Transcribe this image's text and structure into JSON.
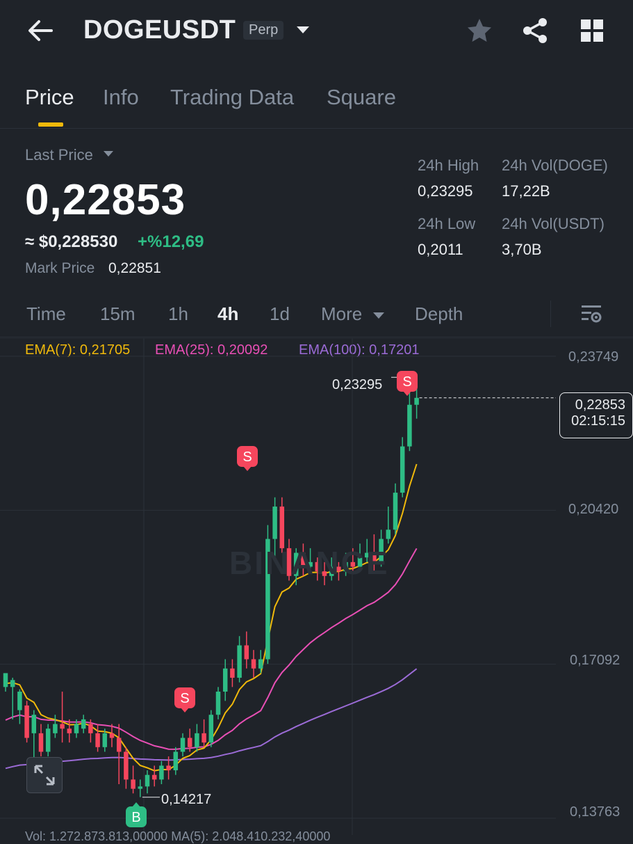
{
  "header": {
    "symbol": "DOGEUSDT",
    "contract_type": "Perp",
    "icons": [
      "back-arrow-icon",
      "dropdown-caret-icon",
      "star-icon",
      "share-icon",
      "grid-icon"
    ]
  },
  "tabs": [
    {
      "label": "Price",
      "active": true
    },
    {
      "label": "Info"
    },
    {
      "label": "Trading Data"
    },
    {
      "label": "Square"
    }
  ],
  "price": {
    "last_price_label": "Last Price",
    "last_price": "0,22853",
    "approx_usd": "≈ $0,228530",
    "change_pct": "+%12,69",
    "mark_price_label": "Mark Price",
    "mark_price": "0,22851"
  },
  "stats": {
    "high_label": "24h High",
    "high": "0,23295",
    "vol_doge_label": "24h Vol(DOGE)",
    "vol_doge": "17,22B",
    "low_label": "24h Low",
    "low": "0,2011",
    "vol_usdt_label": "24h Vol(USDT)",
    "vol_usdt": "3,70B"
  },
  "intervals": {
    "items": [
      "Time",
      "15m",
      "1h",
      "4h",
      "1d",
      "More",
      "Depth"
    ],
    "active": "4h"
  },
  "indicators": {
    "ema7": "EMA(7): 0,21705",
    "ema25": "EMA(25): 0,20092",
    "ema100": "EMA(100): 0,17201"
  },
  "colors": {
    "background": "#1f2329",
    "up": "#2ebd85",
    "down": "#f6465d",
    "accent": "#f0b90b",
    "ema7": "#f0b90b",
    "ema25": "#e84fb5",
    "ema100": "#9b6bd6"
  },
  "chart_data": {
    "type": "candlestick",
    "watermark": "BINANCE",
    "y_axis_ticks": [
      "0,23749",
      "0,20420",
      "0,17092",
      "0,13763"
    ],
    "ylim": [
      0.13763,
      0.23749
    ],
    "current_price": "0,22853",
    "countdown": "02:15:15",
    "high_marker": "0,23295",
    "low_marker": "0,14217",
    "signals": [
      {
        "label": "S",
        "type": "sell",
        "candle_index": 55,
        "price": 0.1625
      },
      {
        "label": "S",
        "type": "sell",
        "candle_index": 26,
        "price": 0.1635
      },
      {
        "label": "S",
        "type": "sell",
        "candle_index": 34,
        "price": 0.2075
      },
      {
        "label": "B",
        "type": "buy",
        "candle_index": 19,
        "price": 0.138
      }
    ],
    "candles": [
      [
        0.166,
        0.169,
        0.1685,
        0.165
      ],
      [
        0.166,
        0.1675,
        0.168,
        0.159
      ],
      [
        0.161,
        0.165,
        0.1655,
        0.158
      ],
      [
        0.162,
        0.155,
        0.163,
        0.154
      ],
      [
        0.156,
        0.16,
        0.161,
        0.15
      ],
      [
        0.156,
        0.152,
        0.158,
        0.151
      ],
      [
        0.152,
        0.157,
        0.158,
        0.151
      ],
      [
        0.156,
        0.158,
        0.16,
        0.155
      ],
      [
        0.158,
        0.157,
        0.165,
        0.154
      ],
      [
        0.157,
        0.156,
        0.159,
        0.154
      ],
      [
        0.156,
        0.158,
        0.159,
        0.155
      ],
      [
        0.157,
        0.159,
        0.16,
        0.156
      ],
      [
        0.158,
        0.156,
        0.159,
        0.154
      ],
      [
        0.156,
        0.153,
        0.158,
        0.152
      ],
      [
        0.153,
        0.156,
        0.157,
        0.152
      ],
      [
        0.156,
        0.155,
        0.158,
        0.153
      ],
      [
        0.155,
        0.152,
        0.158,
        0.145
      ],
      [
        0.152,
        0.146,
        0.153,
        0.144
      ],
      [
        0.146,
        0.144,
        0.149,
        0.143
      ],
      [
        0.144,
        0.1445,
        0.146,
        0.1422
      ],
      [
        0.1445,
        0.147,
        0.148,
        0.143
      ],
      [
        0.147,
        0.146,
        0.149,
        0.1445
      ],
      [
        0.146,
        0.149,
        0.15,
        0.145
      ],
      [
        0.149,
        0.148,
        0.151,
        0.146
      ],
      [
        0.148,
        0.152,
        0.153,
        0.147
      ],
      [
        0.152,
        0.155,
        0.156,
        0.151
      ],
      [
        0.155,
        0.153,
        0.157,
        0.152
      ],
      [
        0.153,
        0.156,
        0.158,
        0.152
      ],
      [
        0.156,
        0.154,
        0.159,
        0.153
      ],
      [
        0.154,
        0.16,
        0.161,
        0.153
      ],
      [
        0.16,
        0.165,
        0.166,
        0.159
      ],
      [
        0.165,
        0.17,
        0.172,
        0.163
      ],
      [
        0.17,
        0.168,
        0.172,
        0.166
      ],
      [
        0.168,
        0.175,
        0.177,
        0.167
      ],
      [
        0.175,
        0.172,
        0.178,
        0.17
      ],
      [
        0.172,
        0.17,
        0.174,
        0.168
      ],
      [
        0.17,
        0.172,
        0.174,
        0.169
      ],
      [
        0.172,
        0.198,
        0.201,
        0.171
      ],
      [
        0.198,
        0.205,
        0.207,
        0.194
      ],
      [
        0.205,
        0.196,
        0.207,
        0.195
      ],
      [
        0.196,
        0.19,
        0.198,
        0.189
      ],
      [
        0.19,
        0.195,
        0.196,
        0.188
      ],
      [
        0.195,
        0.192,
        0.197,
        0.19
      ],
      [
        0.192,
        0.193,
        0.196,
        0.191
      ],
      [
        0.193,
        0.191,
        0.194,
        0.189
      ],
      [
        0.191,
        0.19,
        0.193,
        0.188
      ],
      [
        0.19,
        0.192,
        0.194,
        0.189
      ],
      [
        0.192,
        0.191,
        0.193,
        0.189
      ],
      [
        0.191,
        0.193,
        0.195,
        0.19
      ],
      [
        0.193,
        0.192,
        0.196,
        0.191
      ],
      [
        0.192,
        0.194,
        0.197,
        0.191
      ],
      [
        0.194,
        0.195,
        0.198,
        0.193
      ],
      [
        0.195,
        0.193,
        0.199,
        0.191
      ],
      [
        0.193,
        0.198,
        0.2,
        0.192
      ],
      [
        0.198,
        0.2,
        0.205,
        0.197
      ],
      [
        0.2,
        0.208,
        0.21,
        0.199
      ],
      [
        0.208,
        0.218,
        0.22,
        0.207
      ],
      [
        0.218,
        0.227,
        0.233,
        0.217
      ],
      [
        0.227,
        0.2285,
        0.2329,
        0.224
      ]
    ]
  },
  "volume_footer": "Vol: 1.272.873.813,00000    MA(5): 2.048.410.232,40000"
}
